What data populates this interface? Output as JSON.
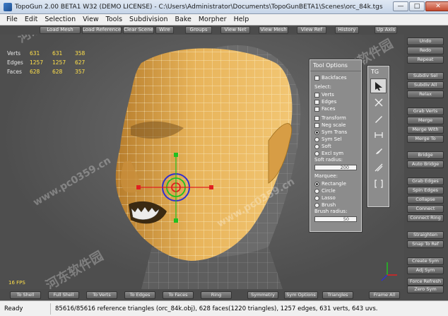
{
  "window": {
    "title": "TopoGun 2.00 BETA1 W32  (DEMO LICENSE)  - C:\\Users\\Administrator\\Documents\\TopoGunBETA1\\Scenes\\orc_84k.tgs",
    "min": "—",
    "max": "□",
    "close": "✕"
  },
  "menu": [
    "File",
    "Edit",
    "Selection",
    "View",
    "Tools",
    "Subdivision",
    "Bake",
    "Morpher",
    "Help"
  ],
  "toolbar": [
    "Load Mesh",
    "Load Reference",
    "Clear Scene",
    "Wire",
    "Groups",
    "View Net",
    "View Mesh",
    "View Ref",
    "History",
    "Up Axis"
  ],
  "stats": {
    "rows": [
      {
        "label": "Verts",
        "v1": "631",
        "v2": "631",
        "v3": "358"
      },
      {
        "label": "Edges",
        "v1": "1257",
        "v2": "1257",
        "v3": "627"
      },
      {
        "label": "Faces",
        "v1": "628",
        "v2": "628",
        "v3": "357"
      }
    ]
  },
  "fps": "16 FPS",
  "tool_options": {
    "title": "Tool Options",
    "backfaces": "Backfaces",
    "select_label": "Select:",
    "verts": "Verts",
    "edges": "Edges",
    "faces": "Faces",
    "transform": "Transform",
    "neg_scale": "Neg scale",
    "sym_trans": "Sym Trans",
    "sym_sel": "Sym Sel",
    "soft": "Soft",
    "excl_sym": "Excl sym",
    "soft_radius_label": "Soft radius:",
    "soft_radius_value": "200",
    "marquee_label": "Marquee:",
    "rectangle": "Rectangle",
    "circle": "Circle",
    "lasso": "Lasso",
    "brush": "Brush",
    "brush_radius_label": "Brush radius:",
    "brush_radius_value": "50"
  },
  "tg_panel": {
    "title": "TG"
  },
  "right_buttons": [
    "Undo",
    "Redo",
    "Repeat",
    "Subdiv Sel",
    "Subdiv All",
    "Relax",
    "Grab Verts",
    "Merge",
    "Merge With",
    "Merge To",
    "Bridge",
    "Auto Bridge",
    "Grab Edges",
    "Spin Edges",
    "Collapse",
    "Connect",
    "Connect Ring",
    "Straighten",
    "Snap To Ref",
    "Create Sym",
    "Adj Sym",
    "Force Refresh",
    "Zero Sym"
  ],
  "bottom_buttons": [
    "To Shell",
    "Full Shell",
    "To Verts",
    "To Edges",
    "To Faces",
    "Ring",
    "Symmetry",
    "Sym Options",
    "Triangles",
    "Frame All"
  ],
  "status": {
    "mode": "Ready",
    "info": "85616/85616 reference triangles (orc_84k.obj), 628 faces(1220 triangles), 1257 edges, 631 verts, 643 uvs."
  },
  "watermarks": [
    "河东软件园",
    "www.pc0359.cn",
    "河东软件园",
    "www.pc0359.cn",
    "河东软件园"
  ],
  "colors": {
    "mesh": "#e8b45a",
    "vertex": "#ffe83a",
    "gizmo_red": "#e02020",
    "gizmo_green": "#20c020",
    "gizmo_blue": "#3030d0"
  }
}
